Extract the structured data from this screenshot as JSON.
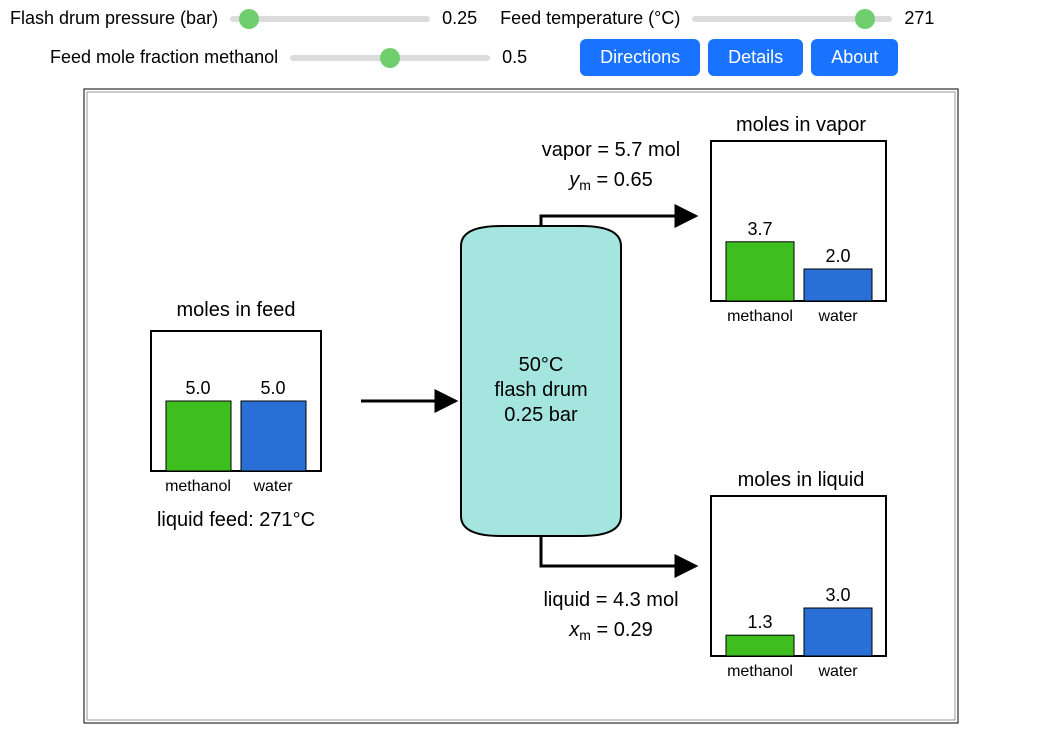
{
  "controls": {
    "pressure": {
      "label": "Flash drum pressure (bar)",
      "value": "0.25"
    },
    "temperature": {
      "label": "Feed temperature (°C)",
      "value": "271"
    },
    "fraction": {
      "label": "Feed mole fraction methanol",
      "value": "0.5"
    }
  },
  "buttons": {
    "directions": "Directions",
    "details": "Details",
    "about": "About"
  },
  "drum": {
    "temp": "50°C",
    "label": "flash drum",
    "pressure": "0.25 bar"
  },
  "vapor": {
    "line1": "vapor = 5.7 mol",
    "y_prefix": "y",
    "y_sub": "m",
    "y_eq": " = 0.65"
  },
  "liquid": {
    "line1": "liquid = 4.3 mol",
    "x_prefix": "x",
    "x_sub": "m",
    "x_eq": " = 0.29"
  },
  "feed": {
    "title": "moles in feed",
    "caption": "liquid feed: 271°C"
  },
  "species": {
    "a": "methanol",
    "b": "water"
  },
  "chart_data": [
    {
      "type": "bar",
      "title": "moles in feed",
      "categories": [
        "methanol",
        "water"
      ],
      "values": [
        5.0,
        5.0
      ],
      "ylim": [
        0,
        10
      ],
      "series_colors": [
        "#3fbf1f",
        "#2a6fd6"
      ]
    },
    {
      "type": "bar",
      "title": "moles in vapor",
      "categories": [
        "methanol",
        "water"
      ],
      "values": [
        3.7,
        2.0
      ],
      "ylim": [
        0,
        10
      ],
      "series_colors": [
        "#3fbf1f",
        "#2a6fd6"
      ]
    },
    {
      "type": "bar",
      "title": "moles in liquid",
      "categories": [
        "methanol",
        "water"
      ],
      "values": [
        1.3,
        3.0
      ],
      "ylim": [
        0,
        10
      ],
      "series_colors": [
        "#3fbf1f",
        "#2a6fd6"
      ]
    }
  ]
}
